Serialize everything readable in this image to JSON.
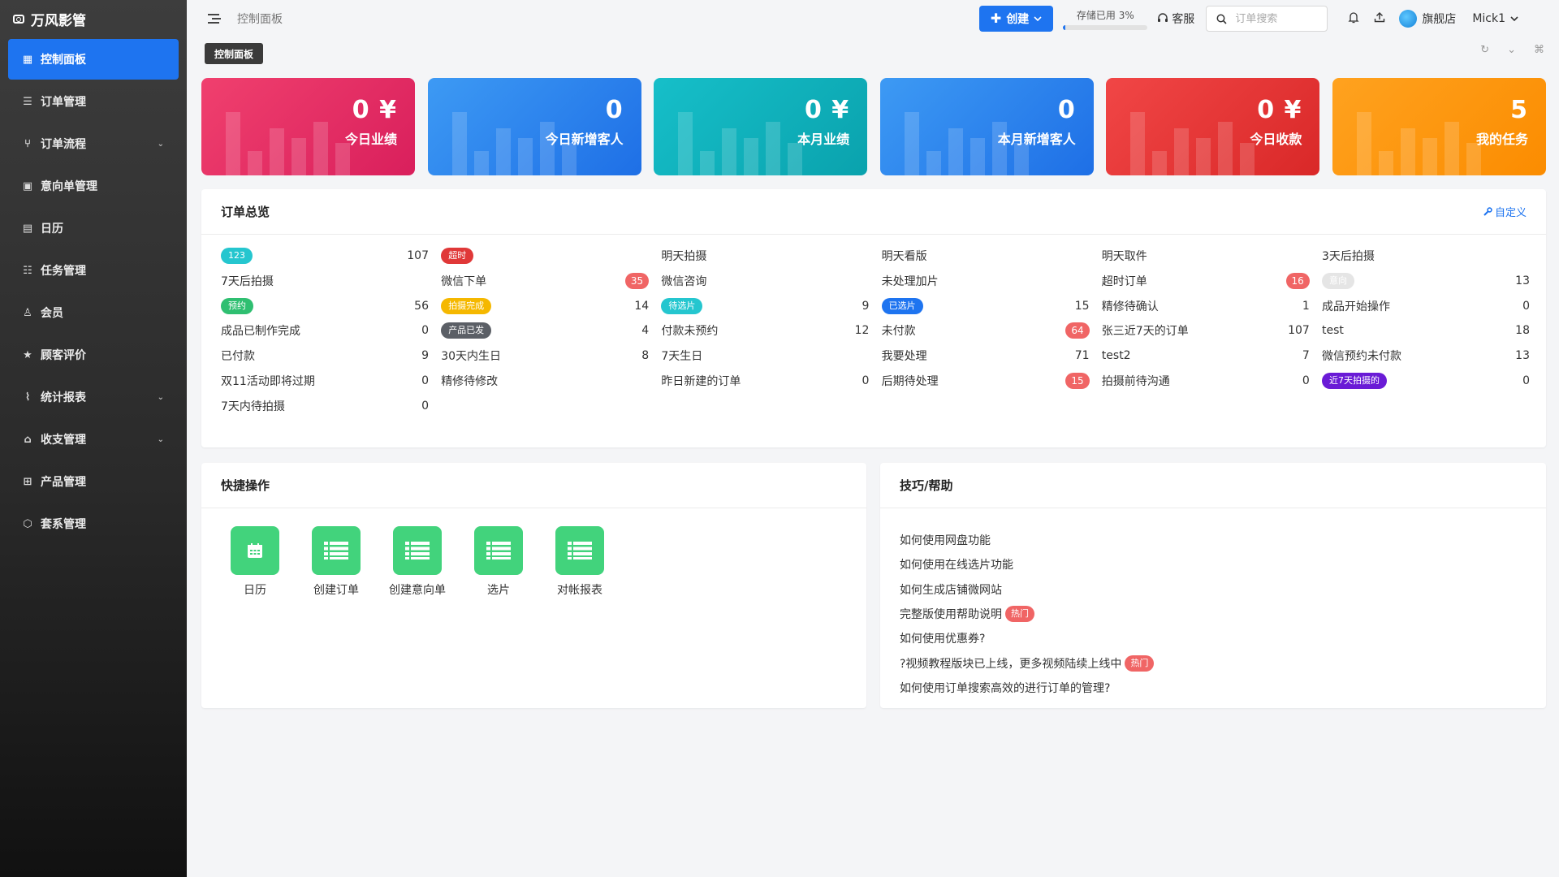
{
  "app": {
    "brand": "万风影管"
  },
  "sidebar": {
    "items": [
      {
        "label": "控制面板",
        "icon": "dashboard-icon",
        "active": true,
        "expandable": false
      },
      {
        "label": "订单管理",
        "icon": "list-icon",
        "active": false,
        "expandable": false
      },
      {
        "label": "订单流程",
        "icon": "flow-icon",
        "active": false,
        "expandable": true
      },
      {
        "label": "意向单管理",
        "icon": "clipboard-icon",
        "active": false,
        "expandable": false
      },
      {
        "label": "日历",
        "icon": "calendar-icon",
        "active": false,
        "expandable": false
      },
      {
        "label": "任务管理",
        "icon": "task-list-icon",
        "active": false,
        "expandable": false
      },
      {
        "label": "会员",
        "icon": "user-icon",
        "active": false,
        "expandable": false
      },
      {
        "label": "顾客评价",
        "icon": "star-icon",
        "active": false,
        "expandable": false
      },
      {
        "label": "统计报表",
        "icon": "chart-line-icon",
        "active": false,
        "expandable": true
      },
      {
        "label": "收支管理",
        "icon": "bank-icon",
        "active": false,
        "expandable": true
      },
      {
        "label": "产品管理",
        "icon": "grid-icon",
        "active": false,
        "expandable": false
      },
      {
        "label": "套系管理",
        "icon": "package-icon",
        "active": false,
        "expandable": false
      }
    ]
  },
  "topbar": {
    "breadcrumb": "控制面板",
    "create_label": "创建",
    "storage_label": "存储已用 3%",
    "storage_percent": 3,
    "support_label": "客服",
    "search_placeholder": "订单搜索",
    "store_name": "旗舰店",
    "username": "Mick1"
  },
  "tabs": {
    "active": "控制面板"
  },
  "stats": [
    {
      "value": "0 ¥",
      "label": "今日业绩",
      "color_from": "#f0406e",
      "color_to": "#d91f5c"
    },
    {
      "value": "0",
      "label": "今日新增客人",
      "color_from": "#3d9af4",
      "color_to": "#1e6fe6"
    },
    {
      "value": "0 ¥",
      "label": "本月业绩",
      "color_from": "#16bfc9",
      "color_to": "#0aa2ad"
    },
    {
      "value": "0",
      "label": "本月新增客人",
      "color_from": "#3d9af4",
      "color_to": "#1e6fe6"
    },
    {
      "value": "0 ¥",
      "label": "今日收款",
      "color_from": "#f14646",
      "color_to": "#d92828"
    },
    {
      "value": "5",
      "label": "我的任务",
      "color_from": "#ffa21f",
      "color_to": "#fb8c00"
    }
  ],
  "overview": {
    "title": "订单总览",
    "customize_label": "自定义",
    "rows": [
      [
        {
          "label": "123",
          "badge": "#25c6cf",
          "value": "107"
        },
        {
          "label": "超时",
          "badge": "#e03838",
          "value": ""
        },
        {
          "label": "明天拍摄",
          "value": ""
        },
        {
          "label": "明天看版",
          "value": ""
        },
        {
          "label": "明天取件",
          "value": ""
        },
        {
          "label": "3天后拍摄",
          "value": ""
        }
      ],
      [
        {
          "label": "7天后拍摄",
          "value": ""
        },
        {
          "label": "微信下单",
          "count": "35"
        },
        {
          "label": "微信咨询",
          "value": ""
        },
        {
          "label": "未处理加片",
          "value": ""
        },
        {
          "label": "超时订单",
          "count": "16"
        },
        {
          "label": "意向",
          "badge": "#e5e5e5",
          "value": "13"
        }
      ],
      [
        {
          "label": "预约",
          "badge": "#2fbf71",
          "value": "56"
        },
        {
          "label": "拍摄完成",
          "badge": "#f5b800",
          "value": "14"
        },
        {
          "label": "待选片",
          "badge": "#25c6cf",
          "value": "9"
        },
        {
          "label": "已选片",
          "badge": "#1e74f0",
          "value": "15"
        },
        {
          "label": "精修待确认",
          "value": "1"
        },
        {
          "label": "成品开始操作",
          "value": "0"
        }
      ],
      [
        {
          "label": "成品已制作完成",
          "value": "0"
        },
        {
          "label": "产品已发",
          "badge": "#5b5f66",
          "value": "4"
        },
        {
          "label": "付款未预约",
          "value": "12"
        },
        {
          "label": "未付款",
          "count": "64"
        },
        {
          "label": "张三近7天的订单",
          "value": "107"
        },
        {
          "label": "test",
          "value": "18"
        }
      ],
      [
        {
          "label": "已付款",
          "value": "9"
        },
        {
          "label": "30天内生日",
          "value": "8"
        },
        {
          "label": "7天生日",
          "value": ""
        },
        {
          "label": "我要处理",
          "value": "71"
        },
        {
          "label": "test2",
          "value": "7"
        },
        {
          "label": "微信预约未付款",
          "value": "13"
        }
      ],
      [
        {
          "label": "双11活动即将过期",
          "value": "0"
        },
        {
          "label": "精修待修改",
          "value": ""
        },
        {
          "label": "昨日新建的订单",
          "value": "0"
        },
        {
          "label": "后期待处理",
          "count": "15"
        },
        {
          "label": "拍摄前待沟通",
          "value": "0"
        },
        {
          "label": "近7天拍摄的",
          "badge": "#6a1bd6",
          "value": "0"
        }
      ],
      [
        {
          "label": "7天内待拍摄",
          "value": "0"
        }
      ]
    ]
  },
  "quick": {
    "title": "快捷操作",
    "items": [
      {
        "label": "日历",
        "icon": "calendar-icon"
      },
      {
        "label": "创建订单",
        "icon": "list-icon"
      },
      {
        "label": "创建意向单",
        "icon": "list-icon"
      },
      {
        "label": "选片",
        "icon": "list-icon"
      },
      {
        "label": "对帐报表",
        "icon": "list-icon"
      }
    ]
  },
  "tips": {
    "title": "技巧/帮助",
    "hot_label": "热门",
    "items": [
      {
        "text": "如何使用网盘功能",
        "hot": false
      },
      {
        "text": "如何使用在线选片功能",
        "hot": false
      },
      {
        "text": "如何生成店铺微网站",
        "hot": false
      },
      {
        "text": "完整版使用帮助说明",
        "hot": true
      },
      {
        "text": "如何使用优惠券?",
        "hot": false
      },
      {
        "text": "?视频教程版块已上线，更多视频陆续上线中",
        "hot": true
      },
      {
        "text": "如何使用订单搜索高效的进行订单的管理?",
        "hot": false
      }
    ]
  }
}
